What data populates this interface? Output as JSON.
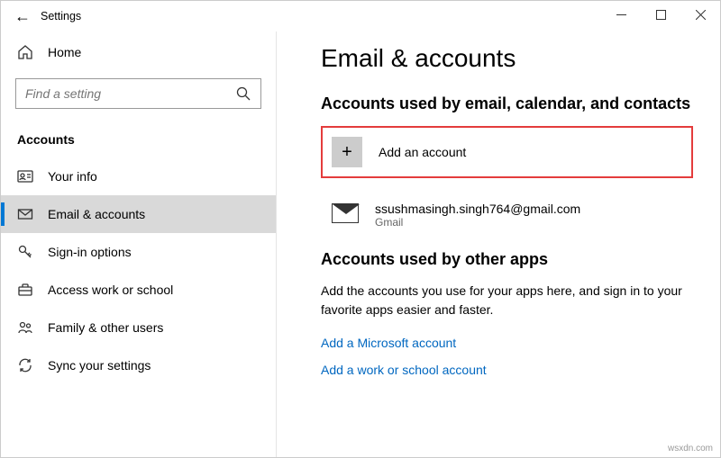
{
  "window": {
    "title": "Settings"
  },
  "sidebar": {
    "home": "Home",
    "search_placeholder": "Find a setting",
    "section": "Accounts",
    "items": [
      {
        "label": "Your info"
      },
      {
        "label": "Email & accounts"
      },
      {
        "label": "Sign-in options"
      },
      {
        "label": "Access work or school"
      },
      {
        "label": "Family & other users"
      },
      {
        "label": "Sync your settings"
      }
    ]
  },
  "main": {
    "heading": "Email & accounts",
    "section1_title": "Accounts used by email, calendar, and contacts",
    "add_account": "Add an account",
    "account_email": "ssushmasingh.singh764@gmail.com",
    "account_provider": "Gmail",
    "section2_title": "Accounts used by other apps",
    "section2_desc": "Add the accounts you use for your apps here, and sign in to your favorite apps easier and faster.",
    "link_ms": "Add a Microsoft account",
    "link_work": "Add a work or school account"
  },
  "watermark": "wsxdn.com"
}
